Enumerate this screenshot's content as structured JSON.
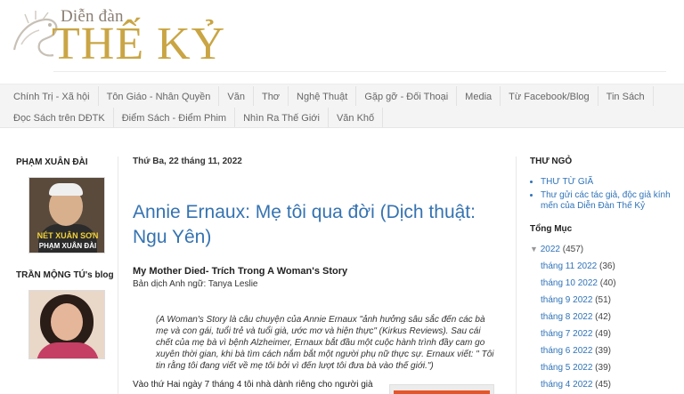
{
  "header": {
    "logo_sub": "Diễn đàn",
    "logo_main": "THẾ KỶ"
  },
  "nav": {
    "row1": [
      "Chính Trị - Xã hội",
      "Tôn Giáo - Nhân Quyền",
      "Văn",
      "Thơ",
      "Nghệ Thuật",
      "Gặp gỡ - Đối Thoại",
      "Media",
      "Từ Facebook/Blog",
      "Tin Sách"
    ],
    "row2": [
      "Đọc Sách trên DĐTK",
      "Điểm Sách - Điểm Phim",
      "Nhìn Ra Thế Giới",
      "Văn Khố"
    ]
  },
  "left": {
    "title1": "PHẠM XUÂN ĐÀI",
    "photo1_caption1": "NÉT XUÂN SƠN",
    "photo1_caption2": "PHẠM XUÂN ĐÀI",
    "title2": "TRẦN MỘNG TÚ's blog"
  },
  "main": {
    "date": "Thứ Ba, 22 tháng 11, 2022",
    "title": "Annie Ernaux: Mẹ tôi qua đời (Dịch thuật: Ngu Yên)",
    "subtitle": "My Mother Died- Trích Trong A Woman's Story",
    "translator": "Bản dịch Anh ngữ: Tanya Leslie",
    "quote": "(A Woman's Story là câu chuyện của Annie Ernaux \"ảnh hưởng sâu sắc đến các bà mẹ và con gái, tuổi trẻ và tuổi già, ước mơ và hiện thực\" (Kirkus Reviews). Sau cái chết của mẹ bà vì bệnh Alzheimer, Ernaux bắt đầu một cuộc hành trình đầy cam go xuyên thời gian, khi bà tìm cách nắm bắt một người phụ nữ thực sự. Ernaux viết: \" Tôi tin rằng tôi đang viết về mẹ tôi bởi vì đến lượt tôi đưa bà vào thế giới.\")",
    "body": "Vào thứ Hai ngày 7 tháng 4 tôi nhà dành riêng cho người già"
  },
  "right": {
    "thu_ngo_title": "THƯ NGỎ",
    "thu_ngo_links": [
      "THƯ TỪ GIÃ",
      "Thư gửi các tác giả, độc giả kính mến của Diễn Đàn Thế Kỷ"
    ],
    "archive_title": "Tổng Mục",
    "year": {
      "label": "2022",
      "count": "(457)"
    },
    "months": [
      {
        "label": "tháng 11 2022",
        "count": "(36)"
      },
      {
        "label": "tháng 10 2022",
        "count": "(40)"
      },
      {
        "label": "tháng 9 2022",
        "count": "(51)"
      },
      {
        "label": "tháng 8 2022",
        "count": "(42)"
      },
      {
        "label": "tháng 7 2022",
        "count": "(49)"
      },
      {
        "label": "tháng 6 2022",
        "count": "(39)"
      },
      {
        "label": "tháng 5 2022",
        "count": "(39)"
      },
      {
        "label": "tháng 4 2022",
        "count": "(45)"
      }
    ]
  },
  "colors": {
    "logo_gold": "#c9a544",
    "link_blue": "#2f73b8",
    "title_blue": "#3573b1"
  }
}
